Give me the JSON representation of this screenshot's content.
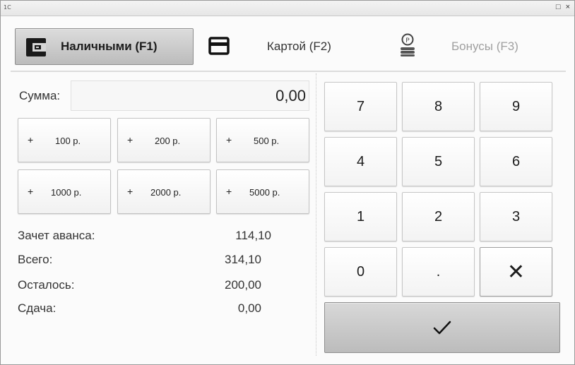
{
  "window": {
    "app_logo": "1С",
    "restore_glyph": "□",
    "close_glyph": "×"
  },
  "tabs": {
    "cash": {
      "label": "Наличными (F1)",
      "icon": "wallet-icon",
      "active": true
    },
    "card": {
      "label": "Картой (F2)",
      "icon": "card-icon"
    },
    "bonus": {
      "label": "Бонусы (F3)",
      "icon": "bonus-coins-icon",
      "disabled": true
    }
  },
  "sum": {
    "label": "Сумма:",
    "value": "0,00"
  },
  "add_buttons": [
    {
      "plus": "+",
      "amount": "100 р."
    },
    {
      "plus": "+",
      "amount": "200 р."
    },
    {
      "plus": "+",
      "amount": "500 р."
    },
    {
      "plus": "+",
      "amount": "1000 р."
    },
    {
      "plus": "+",
      "amount": "2000 р."
    },
    {
      "plus": "+",
      "amount": "5000 р."
    }
  ],
  "summary": {
    "advance_label": "Зачет аванса:",
    "advance_value": "114,10",
    "total_label": "Всего:",
    "total_value": "314,10",
    "remaining_label": "Осталось:",
    "remaining_value": "200,00",
    "change_label": "Сдача:",
    "change_value": "0,00"
  },
  "keypad": {
    "keys": [
      "7",
      "8",
      "9",
      "4",
      "5",
      "6",
      "1",
      "2",
      "3",
      "0",
      ".",
      "✕"
    ],
    "ok_icon": "checkmark-icon"
  },
  "colors": {
    "active_tab": "#c9c9c9",
    "disabled_text": "#a0a0a0",
    "ok_button": "#c6c6c6"
  }
}
